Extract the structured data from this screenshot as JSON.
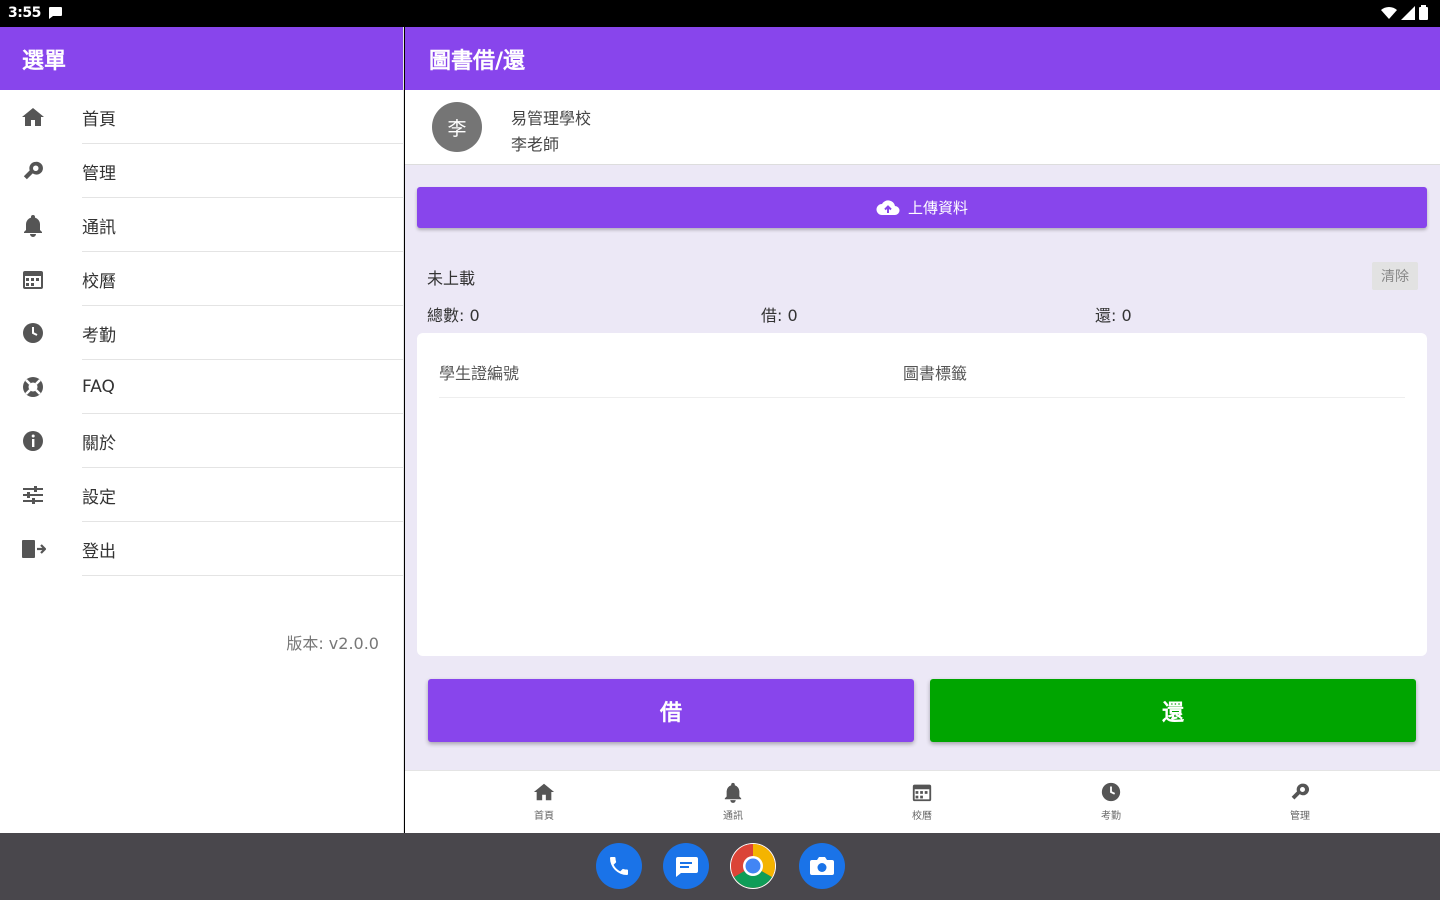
{
  "status_bar": {
    "time": "3:55"
  },
  "sidebar": {
    "title": "選單",
    "items": [
      {
        "label": "首頁",
        "icon": "home-icon"
      },
      {
        "label": "管理",
        "icon": "wrench-icon"
      },
      {
        "label": "通訊",
        "icon": "bell-icon"
      },
      {
        "label": "校曆",
        "icon": "calendar-icon"
      },
      {
        "label": "考勤",
        "icon": "clock-icon"
      },
      {
        "label": "FAQ",
        "icon": "lifebuoy-icon"
      },
      {
        "label": "關於",
        "icon": "info-icon"
      },
      {
        "label": "設定",
        "icon": "sliders-icon"
      },
      {
        "label": "登出",
        "icon": "logout-icon"
      }
    ],
    "version": "版本: v2.0.0"
  },
  "main": {
    "title": "圖書借/還",
    "profile": {
      "avatar_text": "李",
      "school": "易管理學校",
      "teacher": "李老師"
    },
    "upload_label": "上傳資料",
    "status_text": "未上載",
    "clear_label": "清除",
    "stats": {
      "total": "總數: 0",
      "borrow": "借: 0",
      "return": "還: 0"
    },
    "table": {
      "columns": [
        "學生證編號",
        "圖書標籤"
      ]
    },
    "borrow_label": "借",
    "return_label": "還",
    "colors": {
      "primary": "#8845ec",
      "return": "#00a500"
    }
  },
  "bottom_nav": [
    {
      "label": "首頁",
      "icon": "home-icon"
    },
    {
      "label": "通訊",
      "icon": "bell-icon"
    },
    {
      "label": "校曆",
      "icon": "calendar-icon"
    },
    {
      "label": "考勤",
      "icon": "clock-icon"
    },
    {
      "label": "管理",
      "icon": "wrench-icon"
    }
  ],
  "dock": [
    {
      "icon": "phone-icon"
    },
    {
      "icon": "messages-icon"
    },
    {
      "icon": "chrome-icon"
    },
    {
      "icon": "camera-icon"
    }
  ]
}
